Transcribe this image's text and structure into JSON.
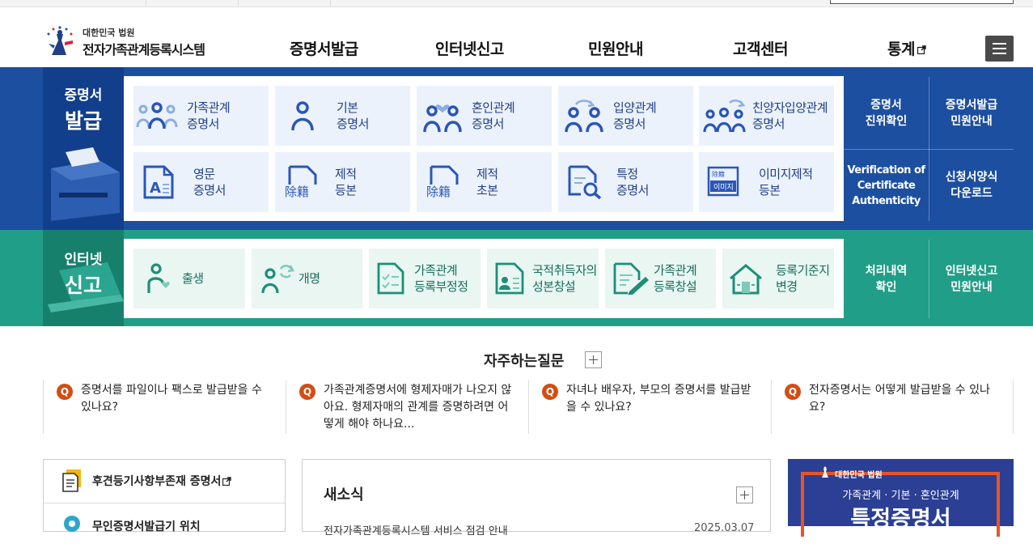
{
  "header": {
    "logo_sub": "대한민국 법원",
    "logo_main": "전자가족관계등록시스템",
    "nav": [
      "증명서발급",
      "인터넷신고",
      "민원안내",
      "고객센터",
      "통계"
    ]
  },
  "certificate": {
    "title_line1": "증명서",
    "title_line2": "발급",
    "cards": [
      {
        "label": "가족관계\n증명서",
        "icon": "family-icon"
      },
      {
        "label": "기본\n증명서",
        "icon": "person-icon"
      },
      {
        "label": "혼인관계\n증명서",
        "icon": "couple-heart-icon"
      },
      {
        "label": "입양관계\n증명서",
        "icon": "adoption-icon"
      },
      {
        "label": "친양자입양관계\n증명서",
        "icon": "full-adoption-icon"
      },
      {
        "label": "영문\n증명서",
        "icon": "english-document-icon"
      },
      {
        "label": "제적\n등본",
        "icon": "removed-register-copy-icon"
      },
      {
        "label": "제적\n초본",
        "icon": "removed-register-extract-icon"
      },
      {
        "label": "특정\n증명서",
        "icon": "magnifier-document-icon"
      },
      {
        "label": "이미지제적\n등본",
        "icon": "image-register-icon"
      }
    ],
    "removed_glyph": "除籍",
    "image_glyph_top": "除籍",
    "image_glyph_bottom": "이미지",
    "english_glyph": "A",
    "side": [
      {
        "label": "증명서\n진위확인"
      },
      {
        "label": "증명서발급\n민원안내"
      },
      {
        "label": "Verification of\nCertificate\nAuthenticity"
      },
      {
        "label": "신청서양식\n다운로드"
      }
    ]
  },
  "report": {
    "title_line1": "인터넷",
    "title_line2": "신고",
    "cards": [
      {
        "label": "출생",
        "icon": "birth-icon"
      },
      {
        "label": "개명",
        "icon": "rename-icon"
      },
      {
        "label": "가족관계\n등록부정정",
        "icon": "checklist-icon"
      },
      {
        "label": "국적취득자의\n성본창설",
        "icon": "nationality-icon"
      },
      {
        "label": "가족관계\n등록창설",
        "icon": "register-create-icon"
      },
      {
        "label": "등록기준지\n변경",
        "icon": "house-icon"
      }
    ],
    "side": [
      {
        "label": "처리내역\n확인"
      },
      {
        "label": "인터넷신고\n민원안내"
      }
    ]
  },
  "faq": {
    "title": "자주하는질문",
    "badge": "Q",
    "items": [
      "증명서를 파일이나 팩스로 발급받을 수 있나요?",
      "가족관계증명서에 형제자매가 나오지 않아요. 형제자매의 관계를 증명하려면 어떻게 해야 하나요...",
      "자녀나 배우자, 부모의 증명서를 발급받을 수 있나요?",
      "전자증명서는 어떻게 발급받을 수 있나요?"
    ]
  },
  "quick": {
    "item1": "후견등기사항부존재 증명서",
    "item2": "무인증명서발급기 위치"
  },
  "news": {
    "title": "새소식",
    "first_item": "전자가족관계등록시스템 서비스 점검 안내",
    "first_date": "2025.03.07"
  },
  "banner": {
    "court": "대한민국 법원",
    "line1": "가족관계 · 기본 · 혼인관계",
    "line2": "특정증명서"
  }
}
